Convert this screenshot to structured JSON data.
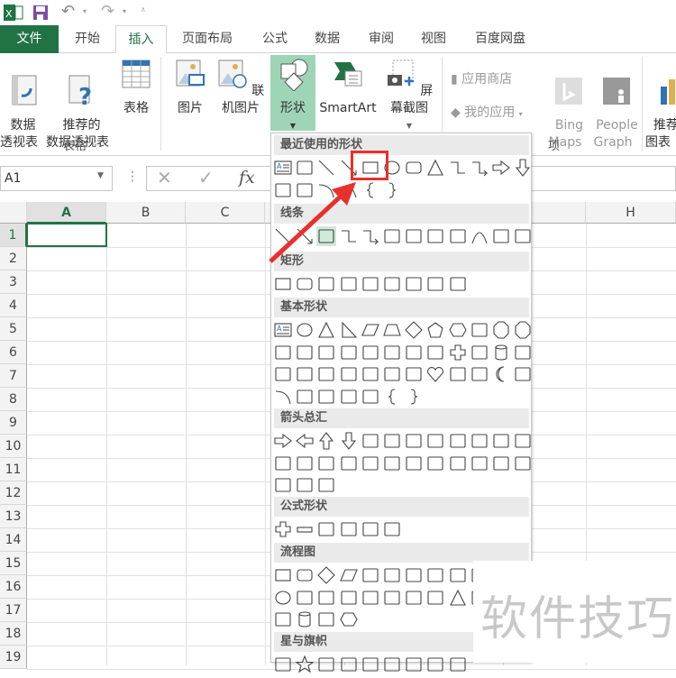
{
  "quick_access": {
    "icons": [
      "excel-logo-icon",
      "save-icon",
      "undo-icon",
      "redo-icon",
      "customize-icon"
    ]
  },
  "tabs": [
    {
      "label": "文件"
    },
    {
      "label": "开始"
    },
    {
      "label": "插入"
    },
    {
      "label": "页面布局"
    },
    {
      "label": "公式"
    },
    {
      "label": "数据"
    },
    {
      "label": "审阅"
    },
    {
      "label": "视图"
    },
    {
      "label": "百度网盘"
    }
  ],
  "active_tab": "插入",
  "ribbon": {
    "pivot": "数据\n透视表",
    "recommended_pivot": "推荐的\n数据透视表",
    "table": "表格",
    "group_tables": "表格",
    "pictures": "图片",
    "online_pictures": "联机图片",
    "shapes": "形状",
    "smartart": "SmartArt",
    "screenshot": "屏幕截图",
    "store": "应用商店",
    "my_apps": "我的应用",
    "bing_maps": "Bing\nMaps",
    "people_graph": "People\nGraph",
    "group_apps_tail": "项",
    "recommended_charts": "推荐的\n图表"
  },
  "formula_bar": {
    "name_box": "A1",
    "fx": "fx"
  },
  "columns": [
    "A",
    "B",
    "C",
    "H"
  ],
  "rows": [
    "1",
    "2",
    "3",
    "4",
    "5",
    "6",
    "7",
    "8",
    "9",
    "10",
    "11",
    "12",
    "13",
    "14",
    "15",
    "16",
    "17",
    "18",
    "19"
  ],
  "accent": "#217346",
  "shapes_panel": {
    "sections": [
      {
        "title": "最近使用的形状",
        "rows": [
          [
            "textbox",
            "vtextbox",
            "line",
            "arrow-line",
            "rect",
            "ellipse",
            "roundrect",
            "triangle",
            "elbow",
            "elbow-arrow",
            "right-arrow",
            "down-arrow"
          ],
          [
            "freeform",
            "scribble",
            "arc",
            "curve",
            "lbrace",
            "rbrace"
          ]
        ]
      },
      {
        "title": "线条",
        "rows": [
          [
            "line",
            "arrow-line",
            "double-arrow-line",
            "elbow",
            "elbow-arrow",
            "elbow-double",
            "curve-conn",
            "curve-arrow",
            "curve-double",
            "curve",
            "freeform",
            "scribble"
          ]
        ]
      },
      {
        "title": "矩形",
        "rows": [
          [
            "rect",
            "roundrect",
            "snip1",
            "snip2",
            "snip3",
            "snipround",
            "round1",
            "round2",
            "round3"
          ]
        ]
      },
      {
        "title": "基本形状",
        "rows": [
          [
            "textbox",
            "ellipse",
            "triangle",
            "rtriangle",
            "parallelogram",
            "trapezoid",
            "diamond",
            "pentagon",
            "hexagon",
            "heptagon",
            "octagon",
            "octagon"
          ],
          [
            "decagon",
            "dodecagon",
            "pie",
            "chord",
            "frame",
            "halfframe",
            "lshape",
            "diagstripe",
            "cross",
            "plaque",
            "can",
            "cube"
          ],
          [
            "cube",
            "bevel",
            "donut",
            "noentry",
            "blockarc",
            "foldedcorner",
            "smiley",
            "heart",
            "lightning",
            "sun",
            "moon",
            "cloud"
          ],
          [
            "arc",
            "dbracket",
            "dbrace",
            "lbracket",
            "rbracket",
            "lbrace",
            "rbrace"
          ]
        ]
      },
      {
        "title": "箭头总汇",
        "rows": [
          [
            "right-arrow",
            "left-arrow",
            "up-arrow",
            "down-arrow",
            "lr-arrow",
            "ud-arrow",
            "quad-arrow",
            "lru-arrow",
            "bent-arrow",
            "uturn",
            "left-up",
            "bent-up"
          ],
          [
            "curved-r",
            "curved-l",
            "curved-u",
            "curved-d",
            "striped",
            "notched",
            "pentagon-arrow",
            "chevron",
            "right-callout",
            "down-callout",
            "left-callout",
            "up-callout"
          ],
          [
            "quad-callout",
            "quad-arrow",
            "circular"
          ]
        ]
      },
      {
        "title": "公式形状",
        "rows": [
          [
            "plus",
            "minus",
            "multiply",
            "divide",
            "equal",
            "notequal"
          ]
        ]
      },
      {
        "title": "流程图",
        "rows": [
          [
            "rect",
            "roundrect",
            "diamond",
            "parallelogram",
            "predefined",
            "internal",
            "document",
            "multidoc",
            "terminator",
            "prep"
          ],
          [
            "ellipse",
            "offpage",
            "card",
            "punched",
            "summing",
            "or",
            "collate",
            "sort",
            "triangle",
            "down-tri"
          ],
          [
            "tape",
            "can",
            "display",
            "hexagon"
          ]
        ]
      },
      {
        "title": "星与旗帜",
        "rows": [
          [
            "star4",
            "star5",
            "star6",
            "star7",
            "star8",
            "star10",
            "star12",
            "star16",
            "star24"
          ]
        ]
      }
    ]
  },
  "annotation": {
    "color": "#e8302c"
  },
  "watermark": "软件技巧"
}
